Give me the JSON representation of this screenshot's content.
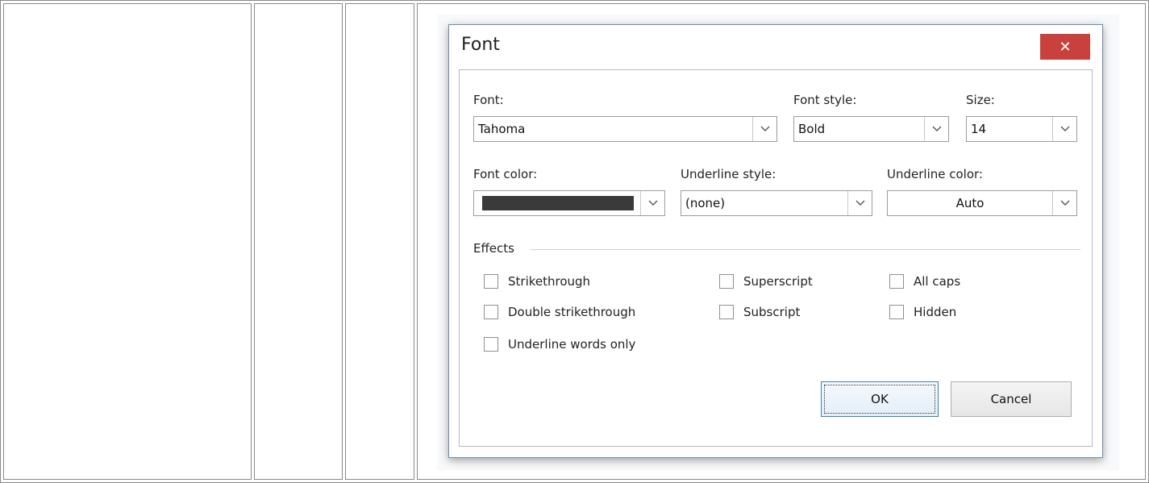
{
  "dialog": {
    "title": "Font",
    "close_glyph": "✕"
  },
  "labels": {
    "font": "Font:",
    "font_style": "Font style:",
    "size": "Size:",
    "font_color": "Font color:",
    "underline_style": "Underline style:",
    "underline_color": "Underline color:",
    "effects": "Effects"
  },
  "values": {
    "font": "Tahoma",
    "font_style": "Bold",
    "size": "14",
    "font_color": "#3a3a3a",
    "underline_style": "(none)",
    "underline_color": "Auto"
  },
  "effects": {
    "strikethrough": {
      "label": "Strikethrough",
      "checked": false
    },
    "double_strikethrough": {
      "label": "Double strikethrough",
      "checked": false
    },
    "underline_words_only": {
      "label": "Underline words only",
      "checked": false
    },
    "superscript": {
      "label": "Superscript",
      "checked": false
    },
    "subscript": {
      "label": "Subscript",
      "checked": false
    },
    "all_caps": {
      "label": "All caps",
      "checked": false
    },
    "hidden": {
      "label": "Hidden",
      "checked": false
    }
  },
  "buttons": {
    "ok": "OK",
    "cancel": "Cancel"
  },
  "colors": {
    "close_button": "#c9413c",
    "dialog_border": "#6d8db0",
    "ok_border": "#3c7fb1"
  }
}
